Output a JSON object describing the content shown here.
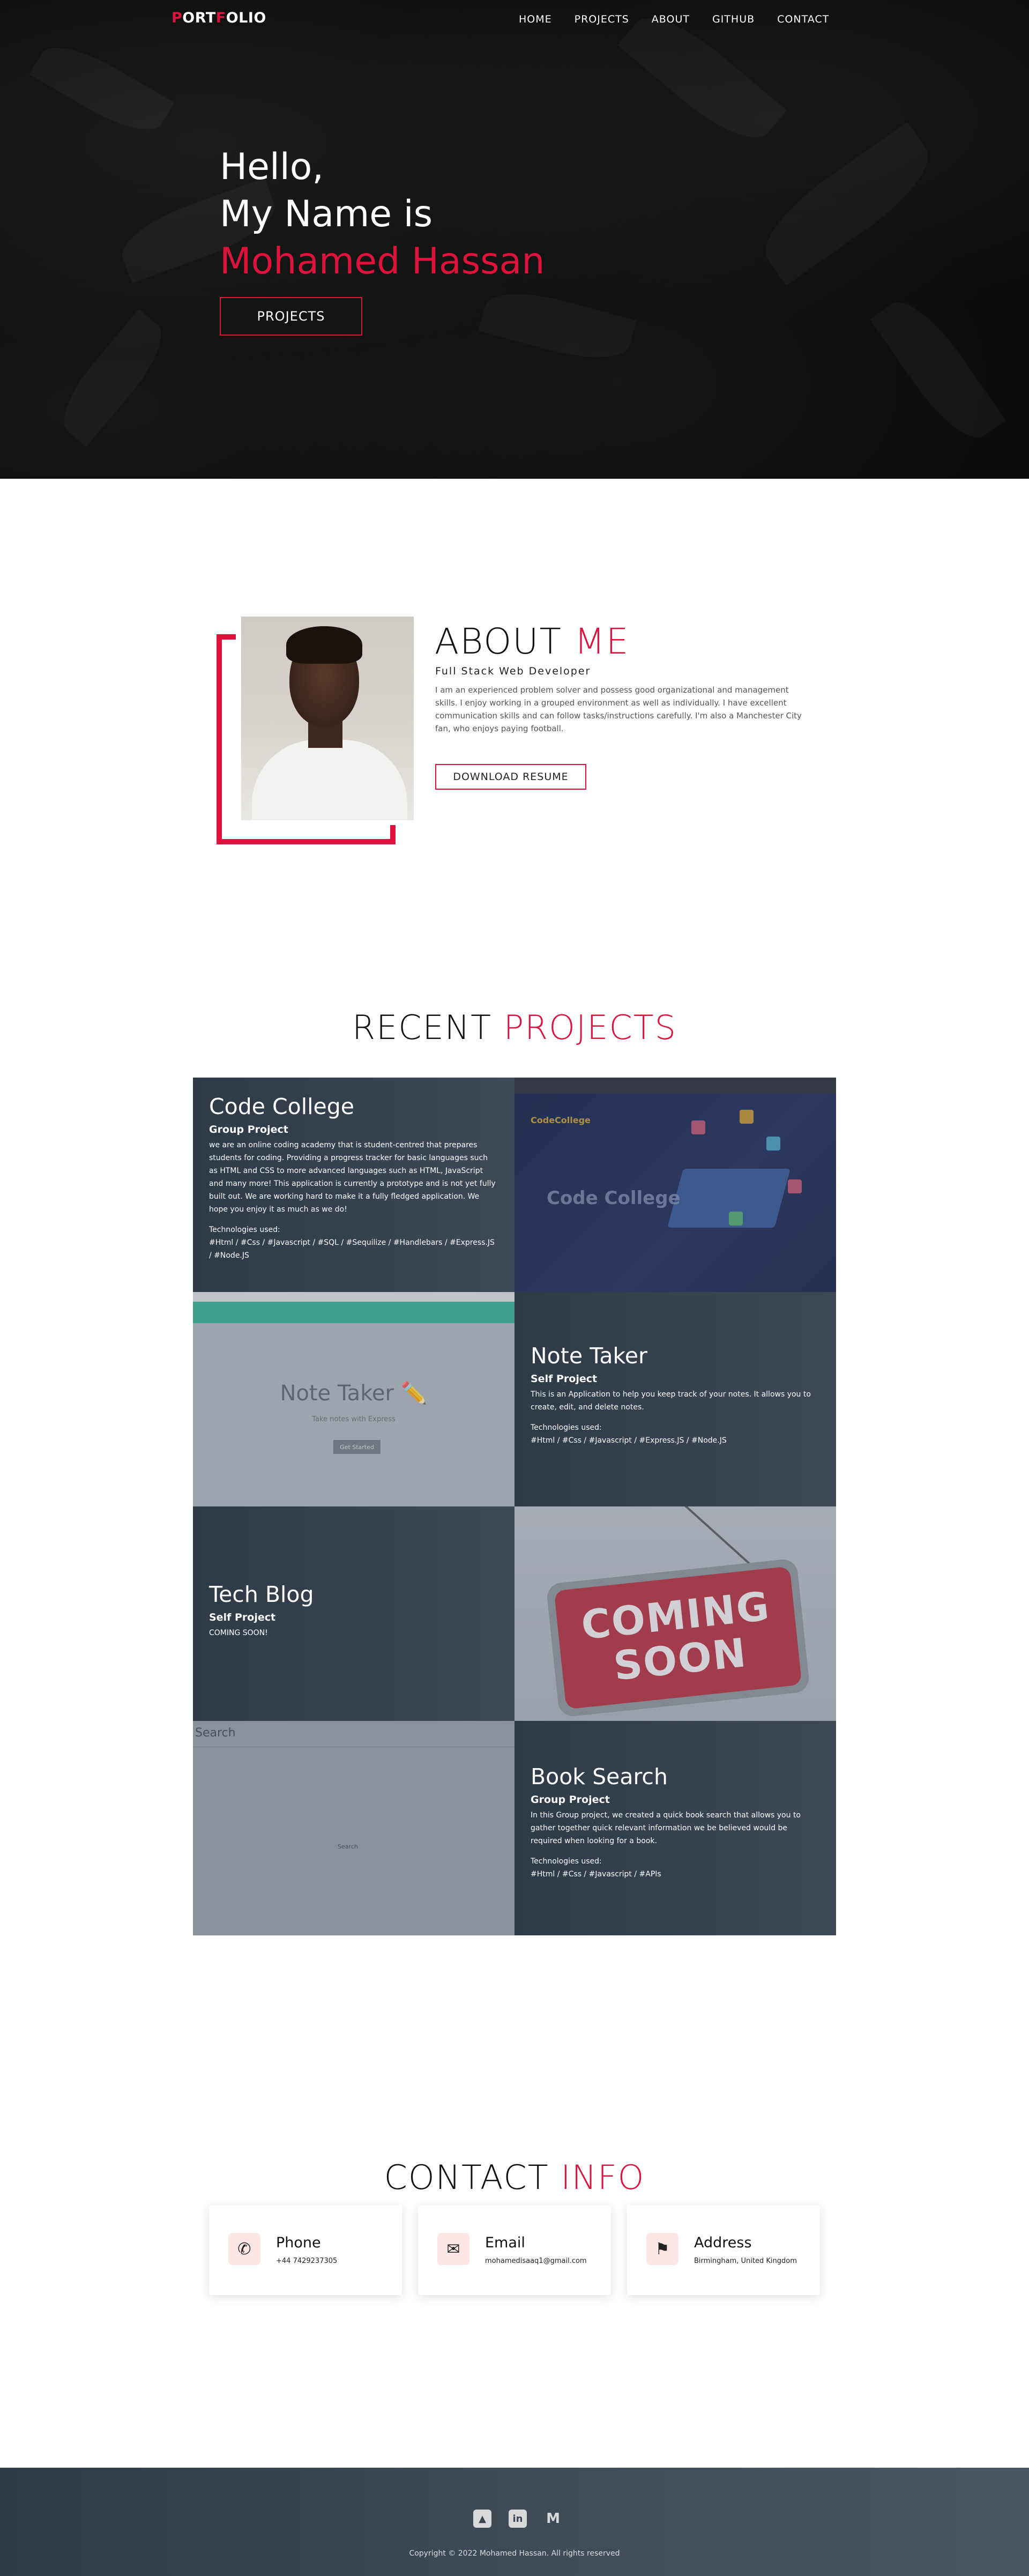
{
  "nav": {
    "logo_first": "P",
    "logo_rest_1": "ORT",
    "logo_accent": "F",
    "logo_rest_2": "OLIO",
    "links": [
      "HOME",
      "PROJECTS",
      "ABOUT",
      "GITHUB",
      "CONTACT"
    ]
  },
  "hero": {
    "line1": "Hello,",
    "line2": "My Name is",
    "name": "Mohamed Hassan",
    "button": "PROJECTS"
  },
  "about": {
    "title_main": "ABOUT",
    "title_accent": "ME",
    "subtitle": "Full Stack Web Developer",
    "body": "I am an experienced problem solver and possess good organizational and management skills. I enjoy working in a grouped environment as well as individually. I have excellent communication skills and can follow tasks/instructions carefully. I'm also a Manchester City fan, who enjoys paying football.",
    "button": "DOWNLOAD RESUME"
  },
  "projects": {
    "title_main": "RECENT",
    "title_accent": "PROJECTS",
    "items": [
      {
        "title": "Code College",
        "kind": "Group Project",
        "desc": "we are an online coding academy that is student-centred that prepares students for coding. Providing a progress tracker for basic languages such as HTML and CSS to more advanced languages such as HTML, JavaScript and many more! This application is currently a prototype and is not yet fully built out. We are working hard to make it a fully fledged application. We hope you enjoy it as much as we do!",
        "tech_label": "Technologies used:",
        "tech": "#Html / #Css / #Javascript / #SQL / #Sequilize / #Handlebars / #Express.JS / #Node.JS"
      },
      {
        "title": "Note Taker",
        "kind": "Self Project",
        "desc": "This is an Application to help you keep track of your notes. It allows you to create, edit, and delete notes.",
        "tech_label": "Technologies used:",
        "tech": "#Html / #Css / #Javascript / #Express.JS / #Node.JS"
      },
      {
        "title": "Tech Blog",
        "kind": "Self Project",
        "desc": "COMING SOON!"
      },
      {
        "title": "Book Search",
        "kind": "Group Project",
        "desc": "In this Group project, we created a quick book search that allows you to gather together quick relevant information we be believed would be required when looking for a book.",
        "tech_label": "Technologies used:",
        "tech": "#Html / #Css / #Javascript / #APIs"
      }
    ],
    "shots": {
      "cc_brand": "CodeCollege",
      "cc_headline": "Code College",
      "nt_title": "Note Taker ✏️",
      "nt_sub": "Take notes with Express",
      "nt_btn": "Get Started",
      "cs_line1": "COMING",
      "cs_line2": "SOON",
      "bs_label": "Search",
      "bs_btn": "Search"
    }
  },
  "contact": {
    "title_main": "CONTACT",
    "title_accent": "INFO",
    "cards": [
      {
        "title": "Phone",
        "value": "+44 7429237305",
        "icon": "phone-icon"
      },
      {
        "title": "Email",
        "value": "mohamedisaaq1@gmail.com",
        "icon": "email-icon"
      },
      {
        "title": "Address",
        "value": "Birmingham, United Kingdom",
        "icon": "map-pin-icon"
      }
    ]
  },
  "footer": {
    "copyright": "Copyright © 2022 Mohamed Hassan. All rights reserved"
  },
  "colors": {
    "accent": "#dc143c",
    "dark": "#2f3a47"
  }
}
